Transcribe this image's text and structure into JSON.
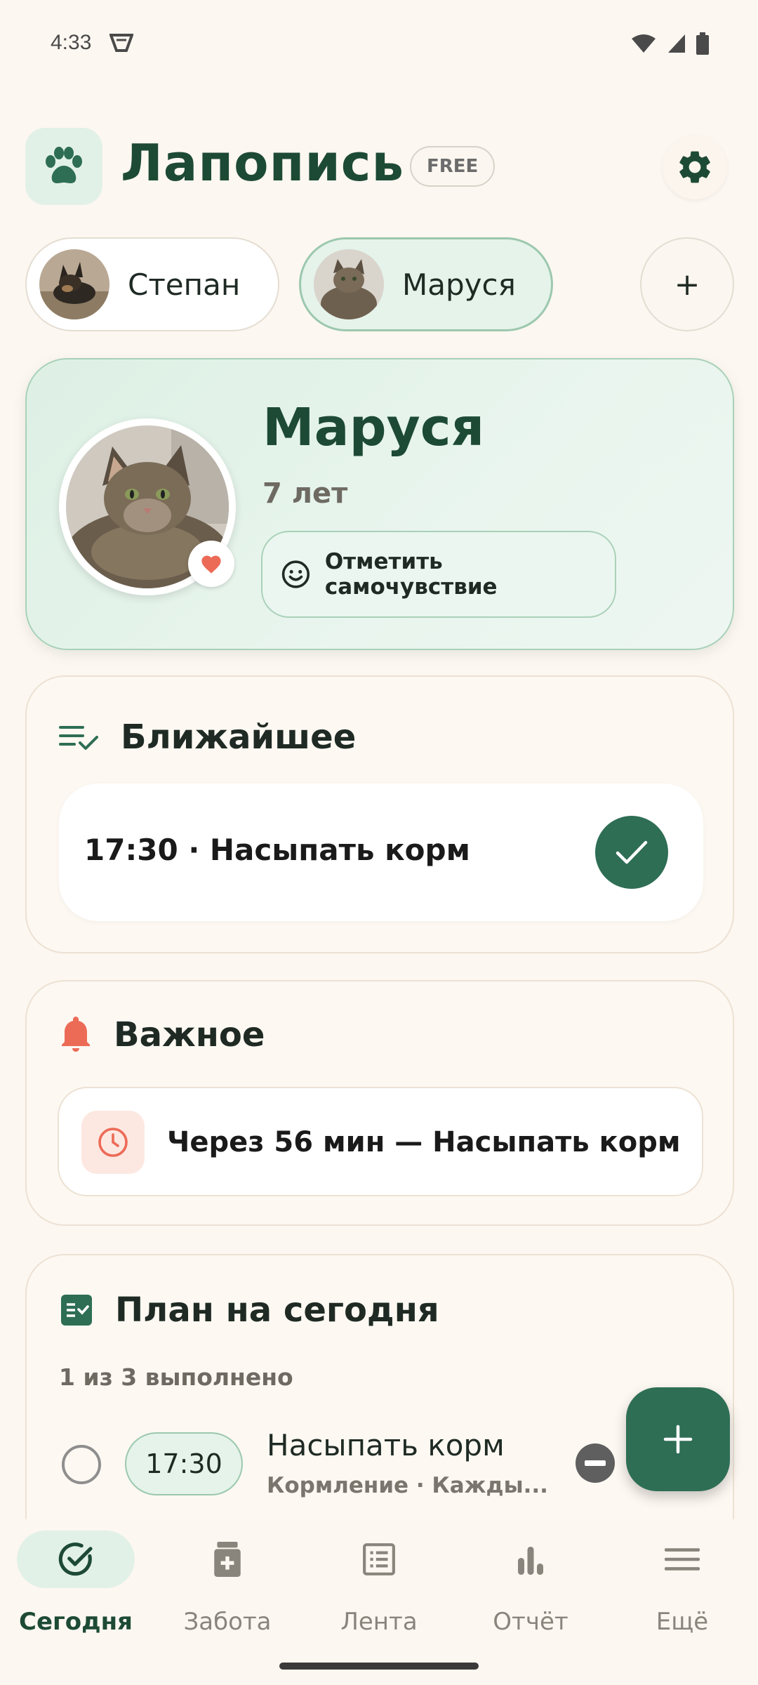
{
  "status_bar": {
    "time": "4:33",
    "icons": [
      "app-notification-icon",
      "wifi-icon",
      "signal-icon",
      "battery-icon"
    ]
  },
  "header": {
    "app_title": "Лапопись",
    "plan_badge": "FREE",
    "logo_icon": "paw-icon",
    "settings_icon": "gear-icon"
  },
  "pet_tabs": [
    {
      "name": "Степан",
      "active": false
    },
    {
      "name": "Маруся",
      "active": true
    }
  ],
  "add_pet_label": "+",
  "pet_card": {
    "name": "Маруся",
    "age": "7 лет",
    "mood_button": "Отметить самочувствие"
  },
  "upcoming": {
    "title": "Ближайшее",
    "item": "17:30 · Насыпать корм"
  },
  "important": {
    "title": "Важное",
    "item": "Через 56 мин — Насыпать корм"
  },
  "plan": {
    "title": "План на сегодня",
    "progress": "1 из 3 выполнено",
    "tasks": [
      {
        "time": "17:30",
        "title": "Насыпать корм",
        "subtitle": "Кормление · Кажды..."
      }
    ]
  },
  "bottom_nav": [
    {
      "label": "Сегодня",
      "icon": "check-circle-icon",
      "active": true
    },
    {
      "label": "Забота",
      "icon": "medicine-icon",
      "active": false
    },
    {
      "label": "Лента",
      "icon": "list-icon",
      "active": false
    },
    {
      "label": "Отчёт",
      "icon": "bar-chart-icon",
      "active": false
    },
    {
      "label": "Ещё",
      "icon": "menu-icon",
      "active": false
    }
  ],
  "colors": {
    "brand_green": "#2e6e55",
    "title_green": "#1d4a35",
    "background": "#fdf7f1",
    "alert_red": "#ec6b57"
  }
}
